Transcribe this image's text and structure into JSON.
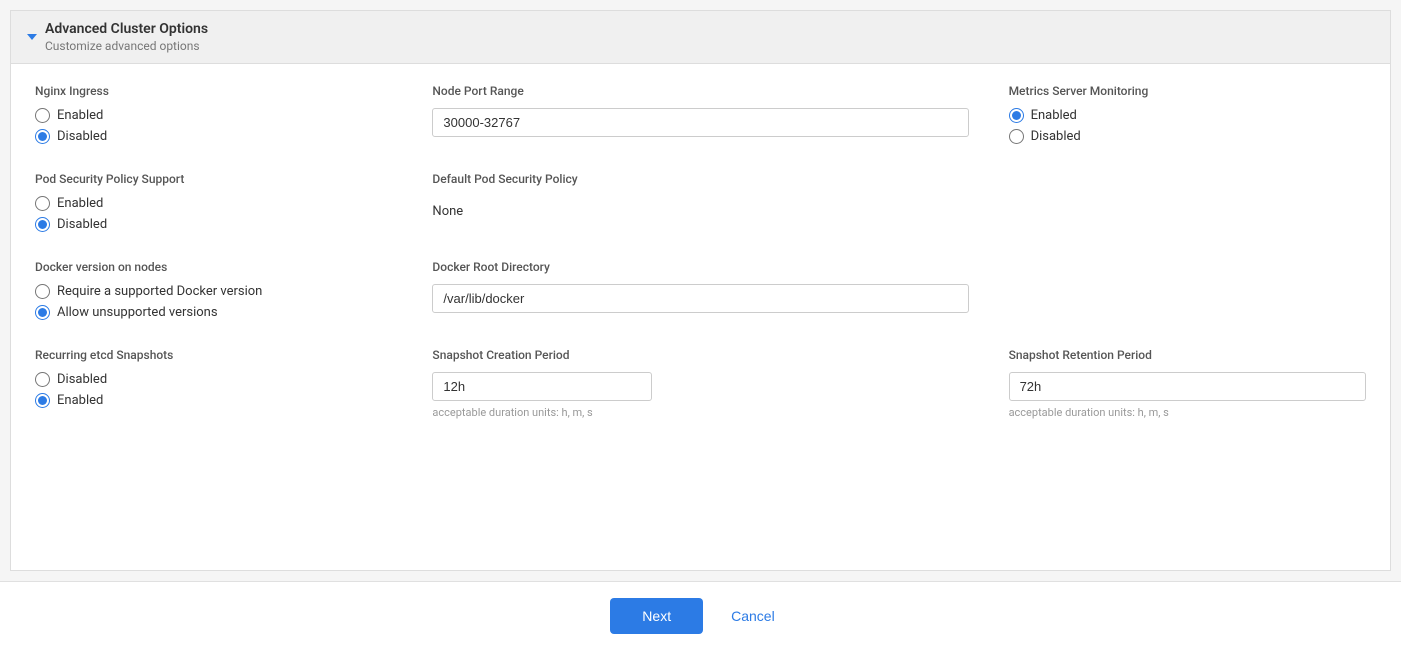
{
  "panel": {
    "title": "Advanced Cluster Options",
    "subtitle": "Customize advanced options"
  },
  "nginx_ingress": {
    "label": "Nginx Ingress",
    "options": [
      "Enabled",
      "Disabled"
    ],
    "selected": "Disabled"
  },
  "node_port_range": {
    "label": "Node Port Range",
    "value": "30000-32767",
    "placeholder": "30000-32767"
  },
  "metrics_server": {
    "label": "Metrics Server Monitoring",
    "options": [
      "Enabled",
      "Disabled"
    ],
    "selected": "Enabled"
  },
  "pod_security_policy": {
    "label": "Pod Security Policy Support",
    "options": [
      "Enabled",
      "Disabled"
    ],
    "selected": "Disabled"
  },
  "default_pod_security": {
    "label": "Default Pod Security Policy",
    "value": "None"
  },
  "docker_version": {
    "label": "Docker version on nodes",
    "options": [
      "Require a supported Docker version",
      "Allow unsupported versions"
    ],
    "selected": "Allow unsupported versions"
  },
  "docker_root_dir": {
    "label": "Docker Root Directory",
    "value": "/var/lib/docker",
    "placeholder": "/var/lib/docker"
  },
  "recurring_etcd": {
    "label": "Recurring etcd Snapshots",
    "options": [
      "Disabled",
      "Enabled"
    ],
    "selected": "Enabled"
  },
  "snapshot_creation": {
    "label": "Snapshot Creation Period",
    "value": "12h",
    "hint": "acceptable duration units: h, m, s"
  },
  "snapshot_retention": {
    "label": "Snapshot Retention Period",
    "value": "72h",
    "hint": "acceptable duration units: h, m, s"
  },
  "footer": {
    "next_label": "Next",
    "cancel_label": "Cancel"
  }
}
